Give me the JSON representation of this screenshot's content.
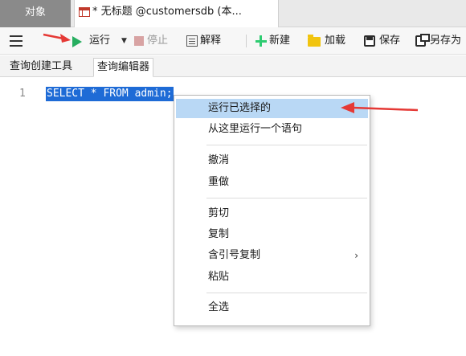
{
  "tabs": {
    "objects": "对象",
    "query": "* 无标题 @customersdb (本..."
  },
  "toolbar": {
    "run": "运行",
    "stop": "停止",
    "explain": "解释",
    "new": "新建",
    "load": "加载",
    "save": "保存",
    "save_as": "另存为"
  },
  "subtabs": {
    "builder": "查询创建工具",
    "editor": "查询编辑器"
  },
  "editor": {
    "line_number": "1",
    "sql": "SELECT * FROM admin;"
  },
  "context_menu": {
    "items": [
      {
        "label": "运行已选择的",
        "highlighted": true
      },
      {
        "label": "从这里运行一个语句"
      },
      {
        "label": "撤消"
      },
      {
        "label": "重做"
      },
      {
        "label": "剪切"
      },
      {
        "label": "复制"
      },
      {
        "label": "含引号复制",
        "has_submenu": true,
        "submenu_arrow": "›"
      },
      {
        "label": "粘贴"
      },
      {
        "label": "全选"
      }
    ]
  },
  "colors": {
    "selection": "#1e6bd6",
    "menu_highlight": "#b9d8f5",
    "annotation_arrow": "#e53935",
    "run_icon": "#27ae60"
  }
}
